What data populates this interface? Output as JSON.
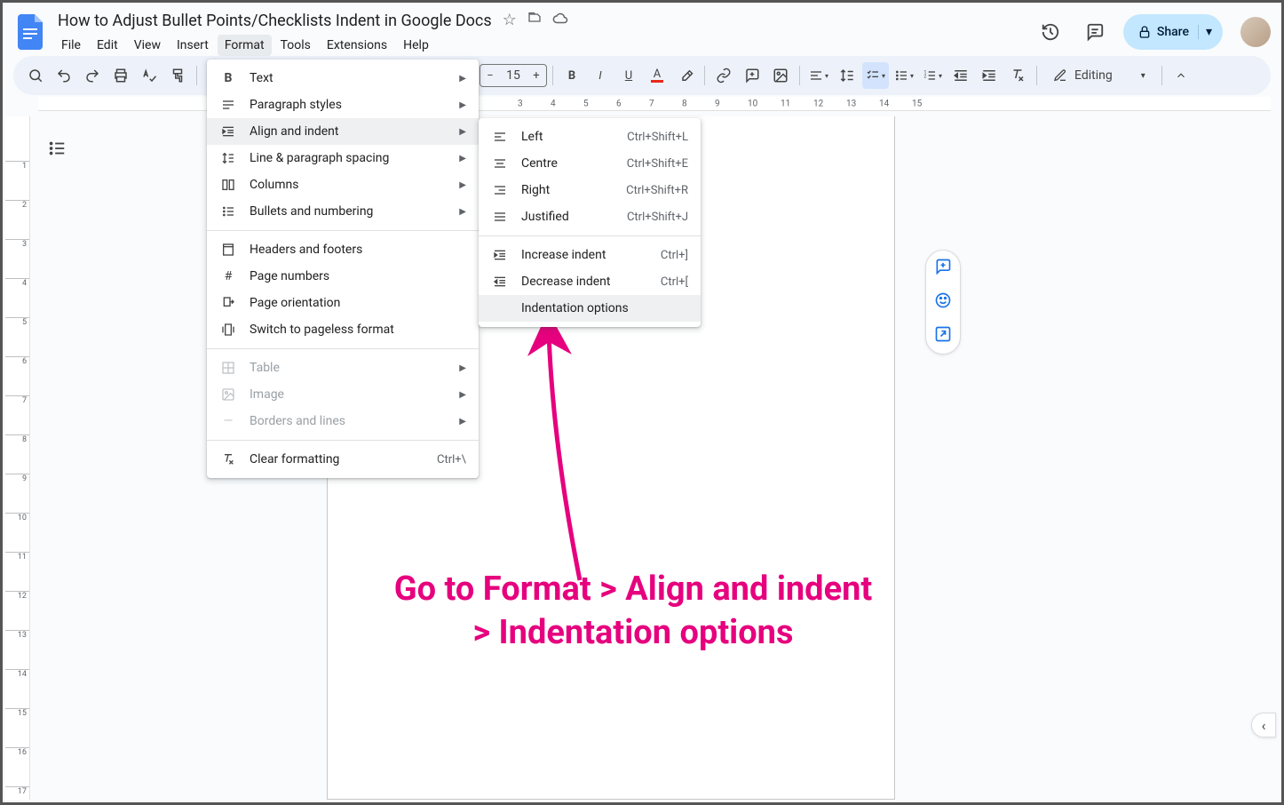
{
  "doc": {
    "title": "How to Adjust Bullet Points/Checklists Indent in Google Docs"
  },
  "menubar": {
    "file": "File",
    "edit": "Edit",
    "view": "View",
    "insert": "Insert",
    "format": "Format",
    "tools": "Tools",
    "extensions": "Extensions",
    "help": "Help"
  },
  "share": {
    "label": "Share"
  },
  "toolbar": {
    "font_size": "15",
    "editing": "Editing"
  },
  "format_menu": {
    "text": "Text",
    "paragraph_styles": "Paragraph styles",
    "align_indent": "Align and indent",
    "line_spacing": "Line & paragraph spacing",
    "columns": "Columns",
    "bullets_numbering": "Bullets and numbering",
    "headers_footers": "Headers and footers",
    "page_numbers": "Page numbers",
    "page_orientation": "Page orientation",
    "pageless": "Switch to pageless format",
    "table": "Table",
    "image": "Image",
    "borders_lines": "Borders and lines",
    "clear_formatting": "Clear formatting",
    "clear_sc": "Ctrl+\\"
  },
  "align_menu": {
    "left": "Left",
    "left_sc": "Ctrl+Shift+L",
    "centre": "Centre",
    "centre_sc": "Ctrl+Shift+E",
    "right": "Right",
    "right_sc": "Ctrl+Shift+R",
    "justified": "Justified",
    "justified_sc": "Ctrl+Shift+J",
    "increase": "Increase indent",
    "increase_sc": "Ctrl+]",
    "decrease": "Decrease indent",
    "decrease_sc": "Ctrl+[",
    "indent_options": "Indentation options"
  },
  "annotation": {
    "line1": "Go to Format > Align and indent",
    "line2": "> Indentation options"
  },
  "ruler_h": [
    "3",
    "4",
    "5",
    "6",
    "7",
    "8",
    "9",
    "10",
    "11",
    "12",
    "13",
    "14",
    "15"
  ],
  "ruler_v": [
    "1",
    "2",
    "3",
    "4",
    "5",
    "6",
    "7",
    "8",
    "9",
    "10",
    "11",
    "12",
    "13",
    "14",
    "15",
    "16",
    "17"
  ]
}
